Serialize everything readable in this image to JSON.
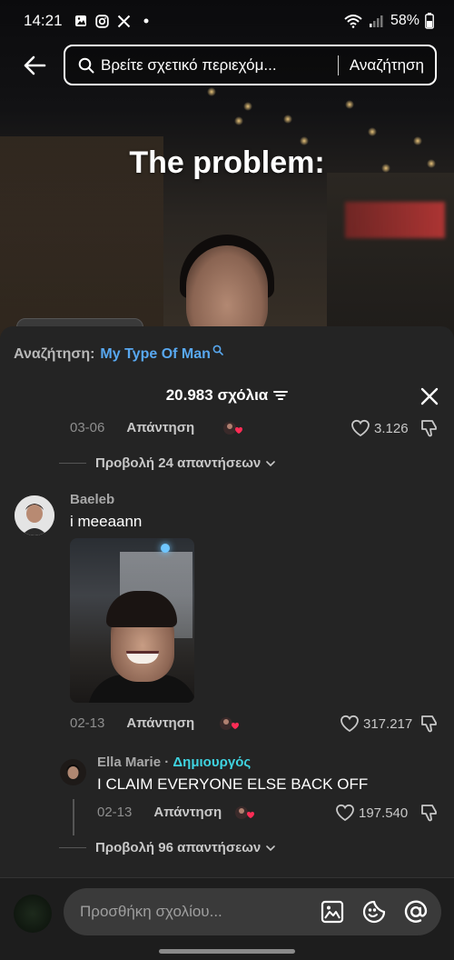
{
  "status_bar": {
    "time": "14:21",
    "notification_icons": [
      "gallery-icon",
      "instagram-icon",
      "x-icon",
      "dot-icon"
    ],
    "battery": "58%"
  },
  "search": {
    "query": "Βρείτε σχετικό περιεχόμ...",
    "button_label": "Αναζήτηση"
  },
  "video": {
    "caption": "The problem:"
  },
  "sheet": {
    "search_prefix": "Αναζήτηση:",
    "search_term": "My Type Of Man",
    "comment_count": "20.983 σχόλια",
    "top_comment": {
      "date": "03-06",
      "reply_label": "Απάντηση",
      "likes": "3.126"
    },
    "view_replies_1": "Προβολή 24 απαντήσεων",
    "comment_baeleb": {
      "username": "Baeleb",
      "text": "i meeaann",
      "date": "02-13",
      "reply_label": "Απάντηση",
      "likes": "317.217"
    },
    "reply_ella": {
      "username": "Ella Marie",
      "separator": " · ",
      "creator_tag": "Δημιουργός",
      "text": "I CLAIM EVERYONE ELSE BACK OFF",
      "date": "02-13",
      "reply_label": "Απάντηση",
      "likes": "197.540"
    },
    "view_replies_2": "Προβολή 96 απαντήσεων"
  },
  "comment_input": {
    "placeholder": "Προσθήκη σχολίου..."
  },
  "colors": {
    "sheet_bg": "#242424",
    "link_blue": "#58a8f0",
    "creator_cyan": "#3fd3e0",
    "heart_red": "#fe2c55"
  }
}
